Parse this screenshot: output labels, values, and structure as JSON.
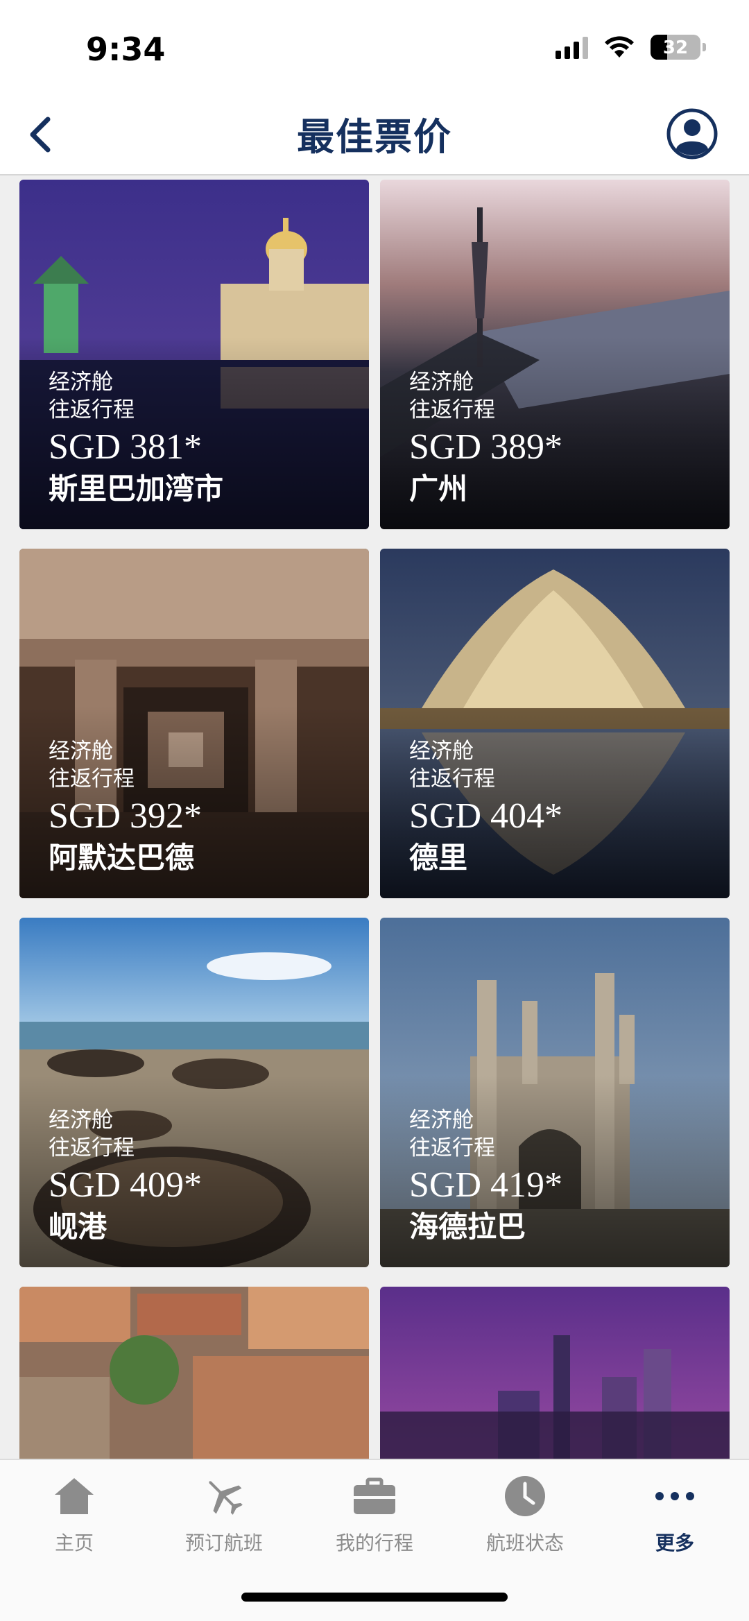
{
  "status_bar": {
    "time": "9:34",
    "battery": "32"
  },
  "header": {
    "title": "最佳票价"
  },
  "deals": [
    {
      "cabin": "经济舱",
      "trip": "往返行程",
      "price": "SGD 381*",
      "city": "斯里巴加湾市"
    },
    {
      "cabin": "经济舱",
      "trip": "往返行程",
      "price": "SGD 389*",
      "city": "广州"
    },
    {
      "cabin": "经济舱",
      "trip": "往返行程",
      "price": "SGD 392*",
      "city": "阿默达巴德"
    },
    {
      "cabin": "经济舱",
      "trip": "往返行程",
      "price": "SGD 404*",
      "city": "德里"
    },
    {
      "cabin": "经济舱",
      "trip": "往返行程",
      "price": "SGD 409*",
      "city": "岘港"
    },
    {
      "cabin": "经济舱",
      "trip": "往返行程",
      "price": "SGD 419*",
      "city": "海德拉巴"
    }
  ],
  "tabs": [
    {
      "label": "主页",
      "icon": "home-icon"
    },
    {
      "label": "预订航班",
      "icon": "airplane-icon"
    },
    {
      "label": "我的行程",
      "icon": "briefcase-icon"
    },
    {
      "label": "航班状态",
      "icon": "clock-icon"
    },
    {
      "label": "更多",
      "icon": "more-icon",
      "active": true
    }
  ],
  "colors": {
    "brand": "#15305e",
    "tab_inactive": "#8c8c8c"
  }
}
